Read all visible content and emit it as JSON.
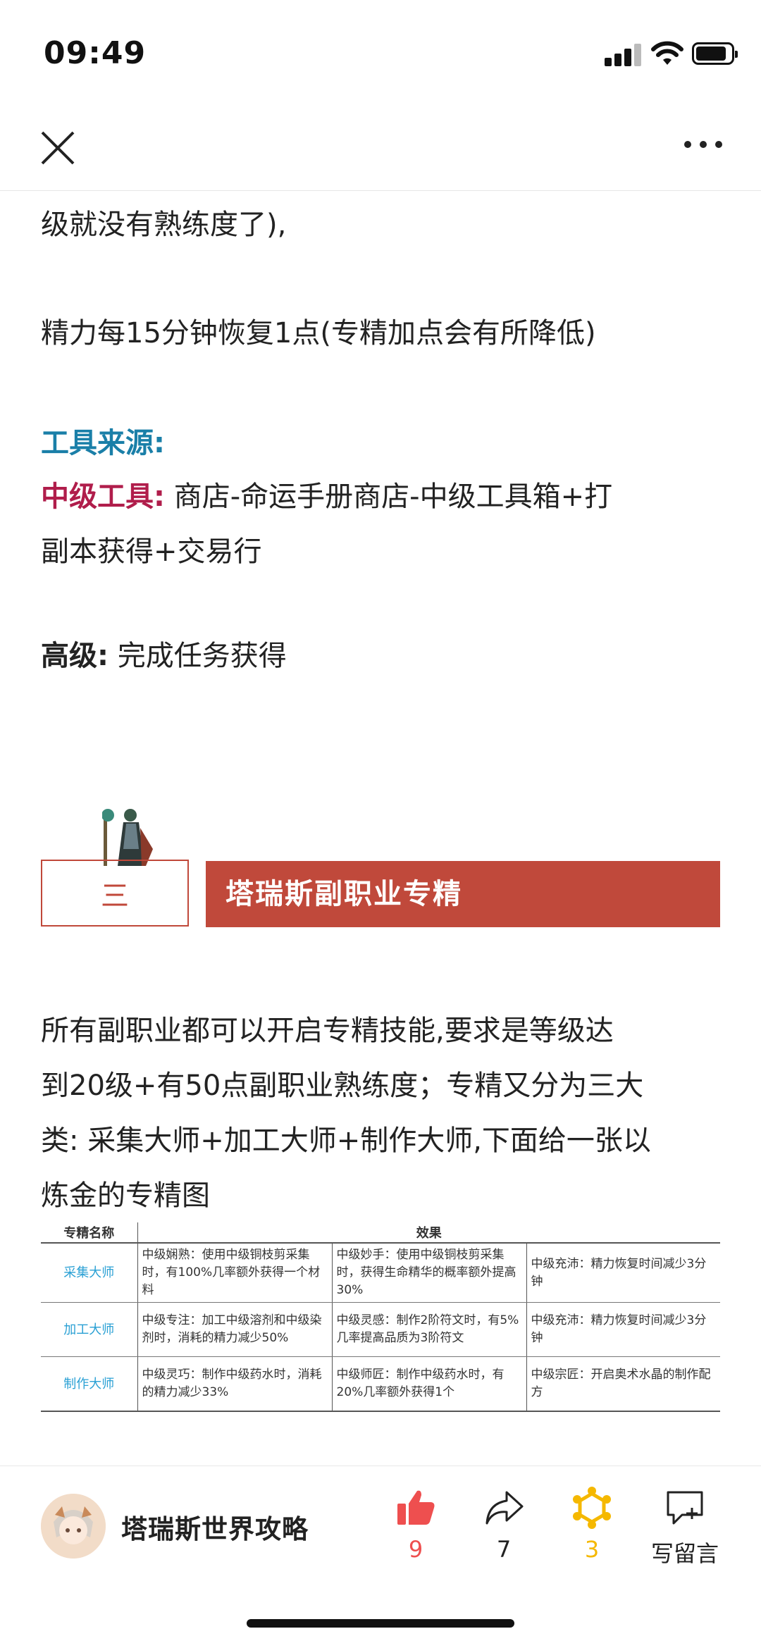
{
  "status_bar": {
    "time": "09:49"
  },
  "article": {
    "line1": "级就没有熟练度了),",
    "line2": "精力每15分钟恢复1点(专精加点会有所降低)",
    "tool_source_heading": "工具来源:",
    "mid_tool_label": "中级工具:",
    "mid_tool_text_1": " 商店-命运手册商店-中级工具箱+打",
    "mid_tool_text_2": "副本获得+交易行",
    "high_label": "高级:",
    "high_text": " 完成任务获得",
    "section_number": "三",
    "section_title": "塔瑞斯副职业专精",
    "para_lines": [
      "所有副职业都可以开启专精技能,要求是等级达",
      "到20级+有50点副职业熟练度；专精又分为三大",
      "类: 采集大师+加工大师+制作大师,下面给一张以",
      "炼金的专精图"
    ]
  },
  "table": {
    "headers": [
      "专精名称",
      "效果"
    ],
    "rows": [
      {
        "name": "采集大师",
        "cells": [
          "中级娴熟：使用中级铜枝剪采集时，有100%几率额外获得一个材料",
          "中级妙手：使用中级铜枝剪采集时，获得生命精华的概率额外提高30%",
          "中级充沛：精力恢复时间减少3分钟"
        ]
      },
      {
        "name": "加工大师",
        "cells": [
          "中级专注：加工中级溶剂和中级染剂时，消耗的精力减少50%",
          "中级灵感：制作2阶符文时，有5%几率提高品质为3阶符文",
          "中级充沛：精力恢复时间减少3分钟"
        ]
      },
      {
        "name": "制作大师",
        "cells": [
          "中级灵巧：制作中级药水时，消耗的精力减少33%",
          "中级师匠：制作中级药水时，有20%几率额外获得1个",
          "中级宗匠：开启奥术水晶的制作配方"
        ]
      }
    ]
  },
  "bottom_bar": {
    "account_name": "塔瑞斯世界攻略",
    "like_count": "9",
    "share_count": "7",
    "wow_count": "3",
    "comment_label": "写留言"
  },
  "colors": {
    "blue": "#1a7fa8",
    "red": "#b01d4b",
    "section": "#c0493b",
    "like": "#ee4f4f",
    "wow": "#f5b800"
  }
}
